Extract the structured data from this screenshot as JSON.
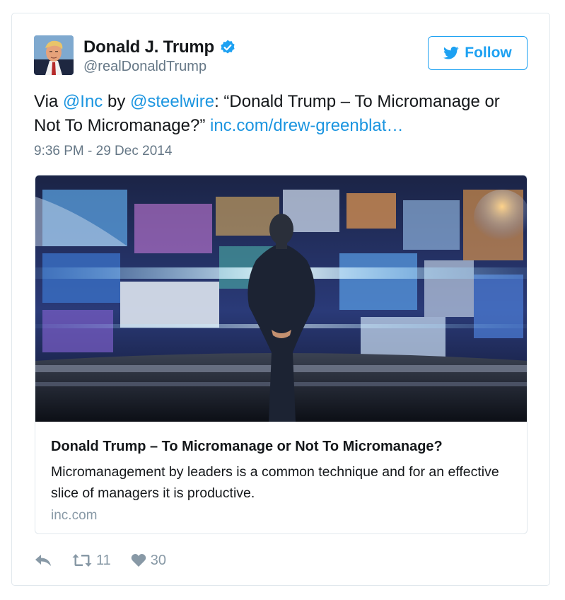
{
  "author": {
    "name": "Donald J. Trump",
    "handle": "@realDonaldTrump",
    "verified": true,
    "avatar": "profile-photo"
  },
  "follow_label": "Follow",
  "tweet": {
    "text_prefix": "Via ",
    "mention_1": "@Inc",
    "text_mid": " by ",
    "mention_2": "@steelwire",
    "text_body": ": “Donald Trump – To Micromanage or Not To Micromanage?” ",
    "link": "inc.com/drew-greenblat…",
    "timestamp": "9:36 PM - 29 Dec 2014"
  },
  "card": {
    "image": "man-in-suit-facing-wall-of-screens",
    "title": "Donald Trump – To Micromanage or Not To Micromanage?",
    "description": "Micromanagement by leaders is a common technique and for an effective slice of managers it is productive.",
    "domain": "inc.com"
  },
  "actions": {
    "reply_icon": "reply-icon",
    "retweet_icon": "retweet-icon",
    "retweet_count": "11",
    "like_icon": "heart-icon",
    "like_count": "30"
  },
  "colors": {
    "link": "#1b95e0",
    "accent": "#1da1f2",
    "muted": "#657786",
    "border": "#e1e8ed"
  }
}
